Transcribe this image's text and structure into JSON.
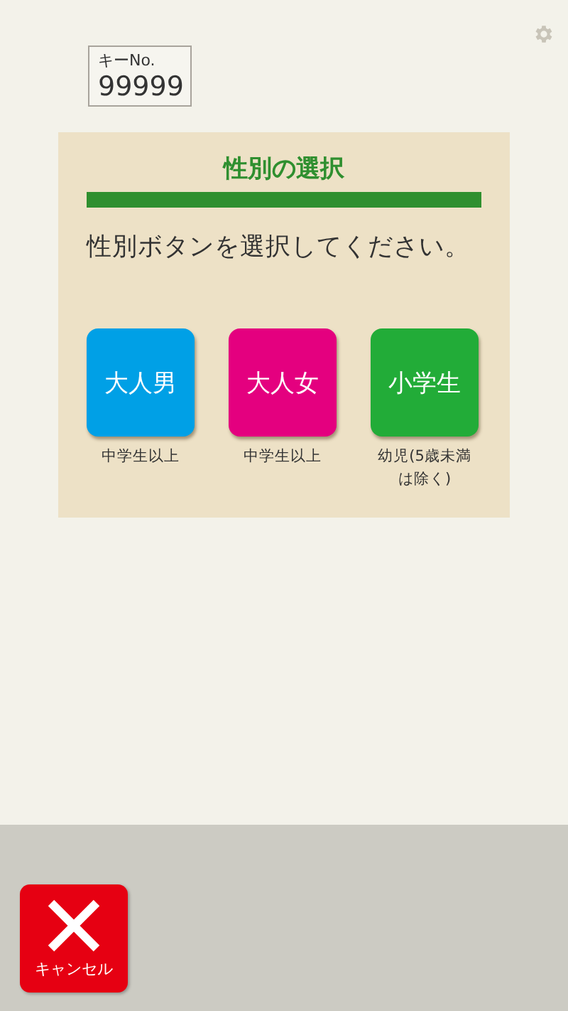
{
  "key_box": {
    "label": "キーNo.",
    "value": "99999"
  },
  "panel": {
    "title": "性別の選択",
    "instruction": "性別ボタンを選択してください。",
    "options": [
      {
        "label": "大人男",
        "note": "中学生以上",
        "color": "#00a0e6"
      },
      {
        "label": "大人女",
        "note": "中学生以上",
        "color": "#e4007f"
      },
      {
        "label": "小学生",
        "note": "幼児(5歳未満は除く)",
        "color": "#22ac38"
      }
    ]
  },
  "cancel_button": {
    "label": "キャンセル"
  }
}
